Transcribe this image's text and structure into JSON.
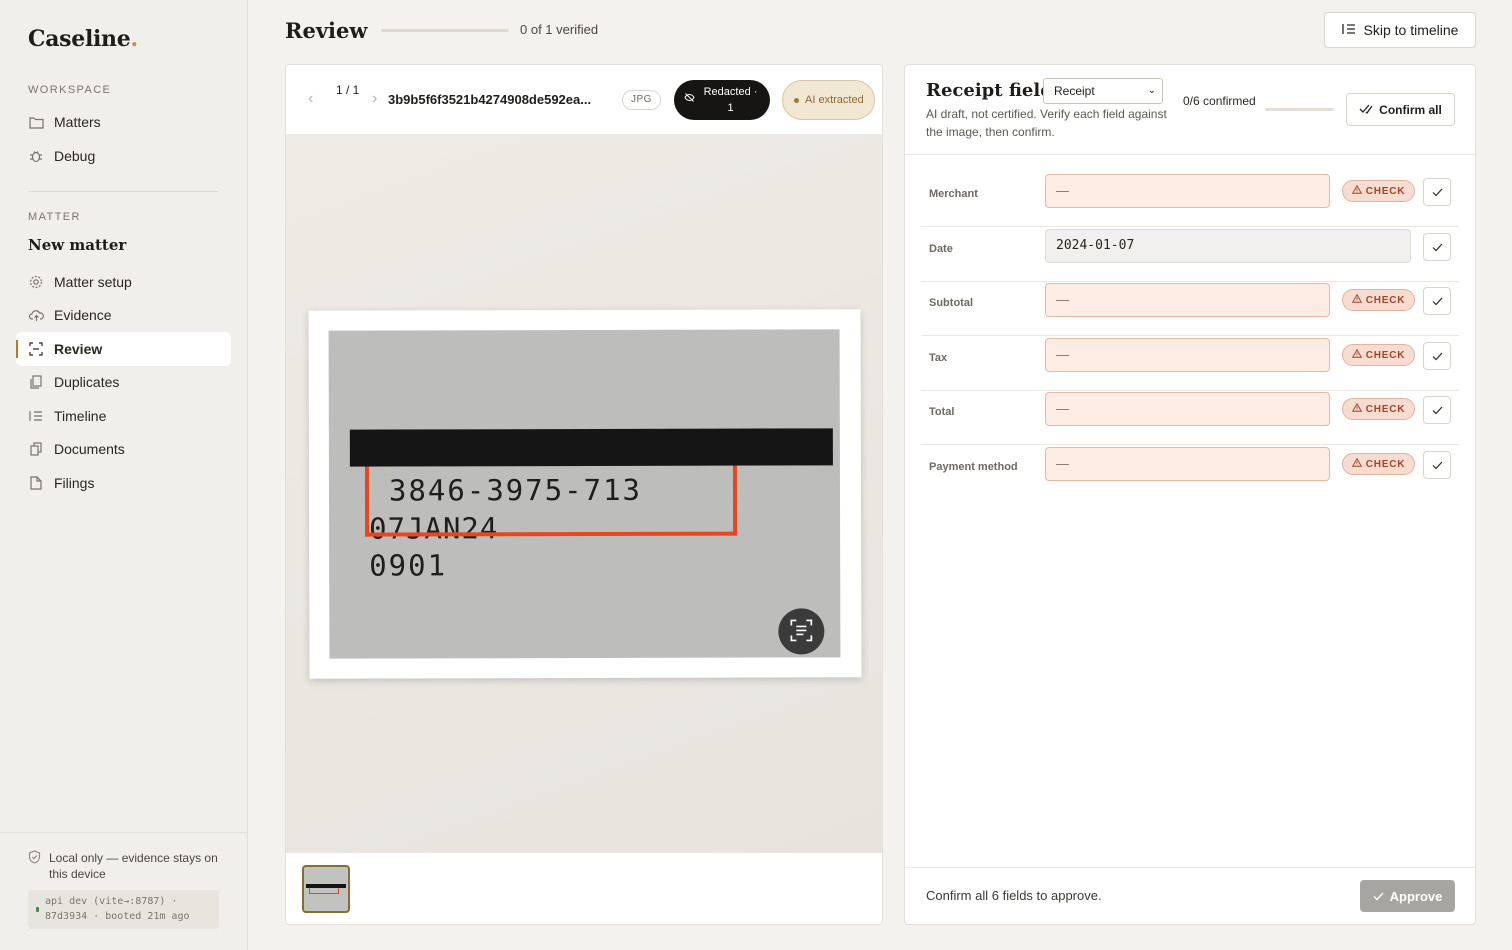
{
  "brand": {
    "name": "Caseline",
    "dot": "."
  },
  "sidebar": {
    "workspace_label": "WORKSPACE",
    "workspace_items": [
      {
        "label": "Matters",
        "icon": "folder-icon"
      },
      {
        "label": "Debug",
        "icon": "bug-icon"
      }
    ],
    "matter_label": "MATTER",
    "matter_title": "New matter",
    "matter_items": [
      {
        "label": "Matter setup",
        "icon": "gear-icon"
      },
      {
        "label": "Evidence",
        "icon": "upload-cloud-icon"
      },
      {
        "label": "Review",
        "icon": "scan-icon",
        "active": true
      },
      {
        "label": "Duplicates",
        "icon": "duplicate-icon"
      },
      {
        "label": "Timeline",
        "icon": "timeline-icon"
      },
      {
        "label": "Documents",
        "icon": "documents-icon"
      },
      {
        "label": "Filings",
        "icon": "file-icon"
      }
    ],
    "footer": {
      "local_note": "Local only — evidence stays on this device",
      "api_line1": "api dev (vite→:8787) ·",
      "api_line2": "87d3934 · booted 21m ago"
    }
  },
  "header": {
    "title": "Review",
    "verified_text": "0 of 1 verified",
    "verified_fraction": 0,
    "skip_button": "Skip to timeline"
  },
  "viewer": {
    "pager": "1 / 1",
    "file_name": "3b9b5f6f3521b4274908de592ea...",
    "extension": "JPG",
    "redacted_label": "Redacted · 1",
    "ai_label": "AI extracted",
    "receipt_lines": [
      "3846-3975-713",
      "07JAN24",
      "0901"
    ]
  },
  "fields_panel": {
    "title": "Receipt fields",
    "type_selected": "Receipt",
    "ai_note": "AI draft, not certified. Verify each field against the image, then confirm.",
    "confirmed_text": "0/6 confirmed",
    "confirmed_fraction": 0,
    "confirm_all": "Confirm all",
    "check_label": "CHECK",
    "fields": [
      {
        "label": "Merchant",
        "value": "—",
        "status": "check"
      },
      {
        "label": "Date",
        "value": "2024-01-07",
        "status": "ok"
      },
      {
        "label": "Subtotal",
        "value": "—",
        "status": "check"
      },
      {
        "label": "Tax",
        "value": "—",
        "status": "check"
      },
      {
        "label": "Total",
        "value": "—",
        "status": "check"
      },
      {
        "label": "Payment method",
        "value": "—",
        "status": "check"
      }
    ],
    "footer_text": "Confirm all 6 fields to approve.",
    "approve_button": "Approve"
  },
  "colors": {
    "accent": "#b07a2a",
    "check_bg": "#fcece4",
    "check_text": "#a5442a",
    "ocr_box": "#e8461f",
    "redaction": "#151515"
  }
}
